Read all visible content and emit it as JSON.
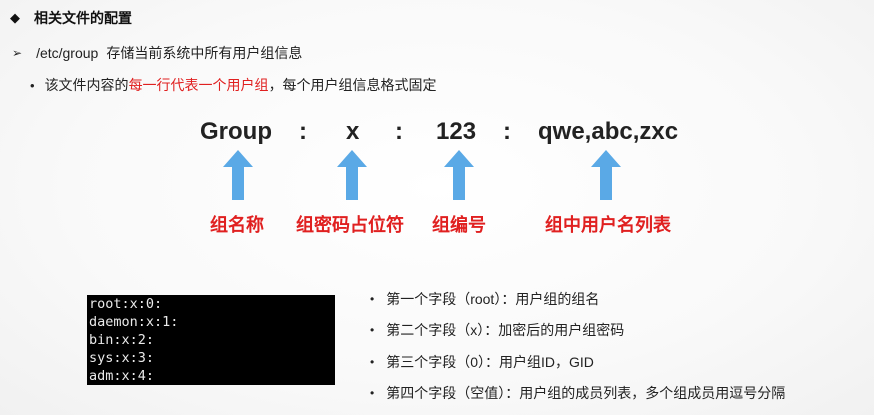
{
  "heading": {
    "bullet": "◆",
    "text": "相关文件的配置"
  },
  "path_line": {
    "bullet": "➢",
    "path": "/etc/group",
    "text": "存储当前系统中所有用户组信息"
  },
  "desc_line": {
    "bullet": "•",
    "prefix": "该文件内容的",
    "highlight": "每一行代表一个用户组",
    "suffix": "，每个用户组信息格式固定"
  },
  "format": {
    "fields": [
      "Group",
      "x",
      "123",
      "qwe,abc,zxc"
    ],
    "separator": ":",
    "labels": [
      "组名称",
      "组密码占位符",
      "组编号",
      "组中用户名列表"
    ]
  },
  "terminal": {
    "lines": [
      "root:x:0:",
      "daemon:x:1:",
      "bin:x:2:",
      "sys:x:3:",
      "adm:x:4:"
    ]
  },
  "bullets": {
    "marker": "•",
    "items": [
      "第一个字段（root）：用户组的组名",
      "第二个字段（x）：加密后的用户组密码",
      "第三个字段（0）：用户组ID，GID",
      "第四个字段（空值）：用户组的成员列表，多个组成员用逗号分隔"
    ]
  },
  "colors": {
    "accent_red": "#e02020",
    "arrow_blue": "#5aa9e6",
    "terminal_bg": "#000000"
  }
}
